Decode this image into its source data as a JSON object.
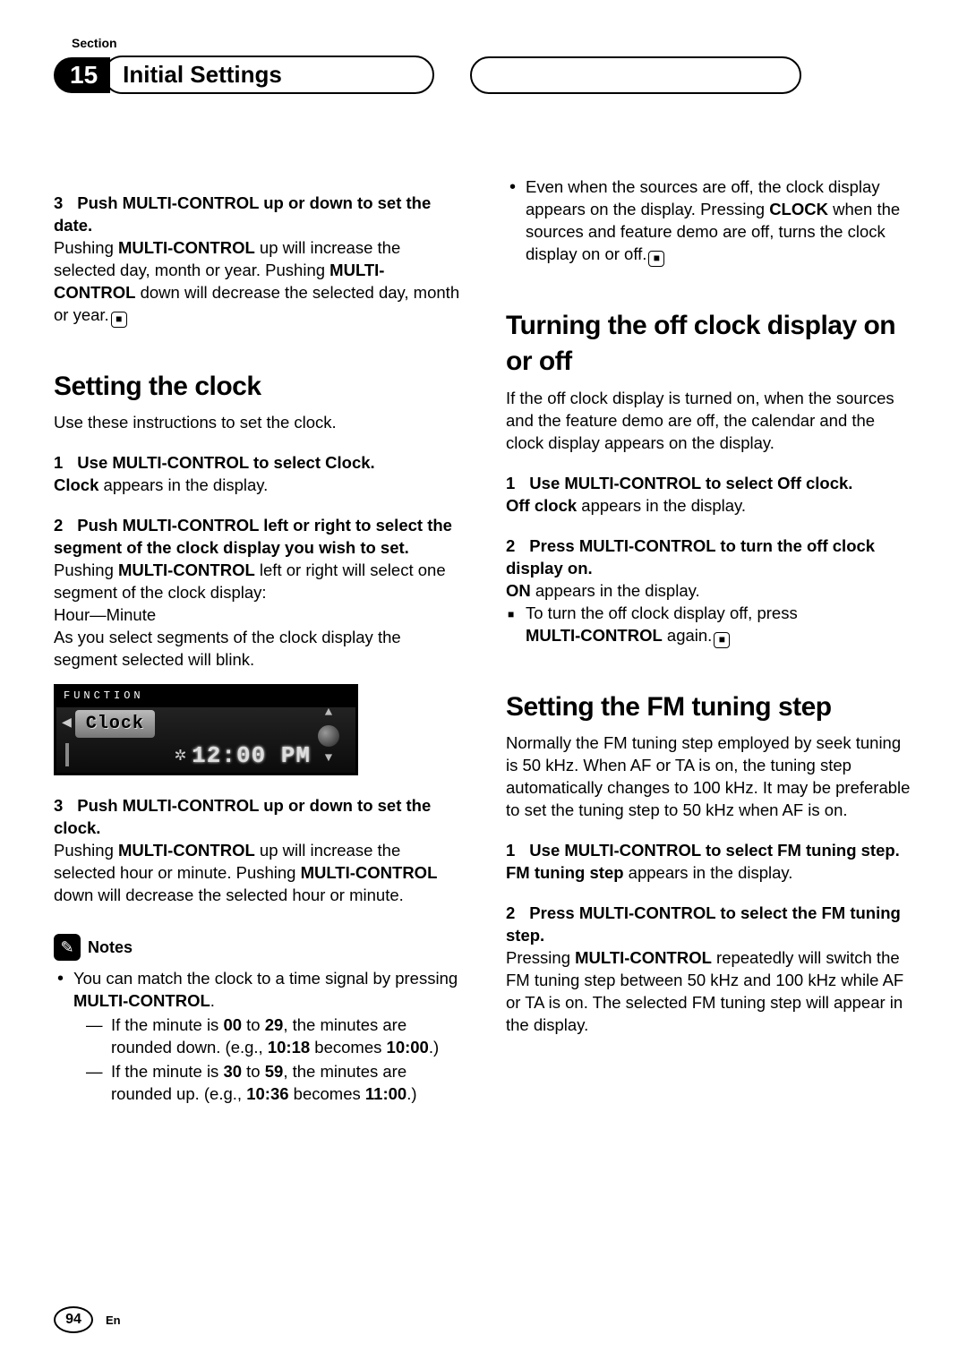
{
  "section_label": "Section",
  "chapter_number": "15",
  "chapter_title": "Initial Settings",
  "left": {
    "step3date_head_num": "3",
    "step3date_head": "Push MULTI-CONTROL up or down to set the date.",
    "step3date_body_1": "Pushing ",
    "step3date_body_b1": "MULTI-CONTROL",
    "step3date_body_2": " up will increase the selected day, month or year. Pushing ",
    "step3date_body_b2": "MULTI-CONTROL",
    "step3date_body_3": " down will decrease the selected day, month or year.",
    "h_clock": "Setting the clock",
    "clock_intro": "Use these instructions to set the clock.",
    "s1_num": "1",
    "s1_head": "Use MULTI-CONTROL to select Clock.",
    "s1_body_b": "Clock",
    "s1_body": " appears in the display.",
    "s2_num": "2",
    "s2_head": "Push MULTI-CONTROL left or right to select the segment of the clock display you wish to set.",
    "s2_body_1": "Pushing ",
    "s2_body_b": "MULTI-CONTROL",
    "s2_body_2": " left or right will select one segment of the clock display:",
    "s2_seg": "Hour—Minute",
    "s2_body_3": "As you select segments of the clock display the segment selected will blink.",
    "display_topbar": "FUNCTION",
    "display_label": "Clock",
    "display_time": "12:00 PM",
    "s3_num": "3",
    "s3_head": "Push MULTI-CONTROL up or down to set the clock.",
    "s3_body_1": "Pushing ",
    "s3_body_b1": "MULTI-CONTROL",
    "s3_body_2": " up will increase the selected hour or minute. Pushing ",
    "s3_body_b2": "MULTI-CONTROL",
    "s3_body_3": " down will decrease the selected hour or minute.",
    "notes_title": "Notes",
    "note1_a": "You can match the clock to a time signal by pressing ",
    "note1_b": "MULTI-CONTROL",
    "note1_c": ".",
    "dash1_a": "If the minute is ",
    "dash1_b1": "00",
    "dash1_b": " to ",
    "dash1_b2": "29",
    "dash1_c": ", the minutes are rounded down. (e.g., ",
    "dash1_b3": "10:18",
    "dash1_d": " becomes ",
    "dash1_b4": "10:00",
    "dash1_e": ".)",
    "dash2_a": "If the minute is ",
    "dash2_b1": "30",
    "dash2_b": " to ",
    "dash2_b2": "59",
    "dash2_c": ", the minutes are rounded up. (e.g., ",
    "dash2_b3": "10:36",
    "dash2_d": " becomes ",
    "dash2_b4": "11:00",
    "dash2_e": ".)"
  },
  "right": {
    "bullet_a": "Even when the sources are off, the clock display appears on the display. Pressing ",
    "bullet_b": "CLOCK",
    "bullet_c": " when the sources and feature demo are off, turns the clock display on or off.",
    "h_off": "Turning the off clock display on or off",
    "off_intro": "If the off clock display is turned on, when the sources and the feature demo are off, the calendar and the clock display appears on the display.",
    "o1_num": "1",
    "o1_head": "Use MULTI-CONTROL to select Off clock.",
    "o1_body_b": "Off clock",
    "o1_body": " appears in the display.",
    "o2_num": "2",
    "o2_head": "Press MULTI-CONTROL to turn the off clock display on.",
    "o2_body_b": "ON",
    "o2_body": " appears in the display.",
    "o2_sq_a": "To turn the off clock display off, press ",
    "o2_sq_b": "MULTI-CONTROL",
    "o2_sq_c": " again.",
    "h_fm": "Setting the FM tuning step",
    "fm_intro": "Normally the FM tuning step employed by seek tuning is 50 kHz. When AF or TA is on, the tuning step automatically changes to 100 kHz. It may be preferable to set the tuning step to 50 kHz when AF is on.",
    "f1_num": "1",
    "f1_head": "Use MULTI-CONTROL to select FM tuning step.",
    "f1_body_b": "FM tuning step",
    "f1_body": " appears in the display.",
    "f2_num": "2",
    "f2_head": "Press MULTI-CONTROL to select the FM tuning step.",
    "f2_body_1": "Pressing ",
    "f2_body_b": "MULTI-CONTROL",
    "f2_body_2": " repeatedly will switch the FM tuning step between 50 kHz and 100 kHz while AF or TA is on. The selected FM tuning step will appear in the display."
  },
  "page_number": "94",
  "lang": "En"
}
